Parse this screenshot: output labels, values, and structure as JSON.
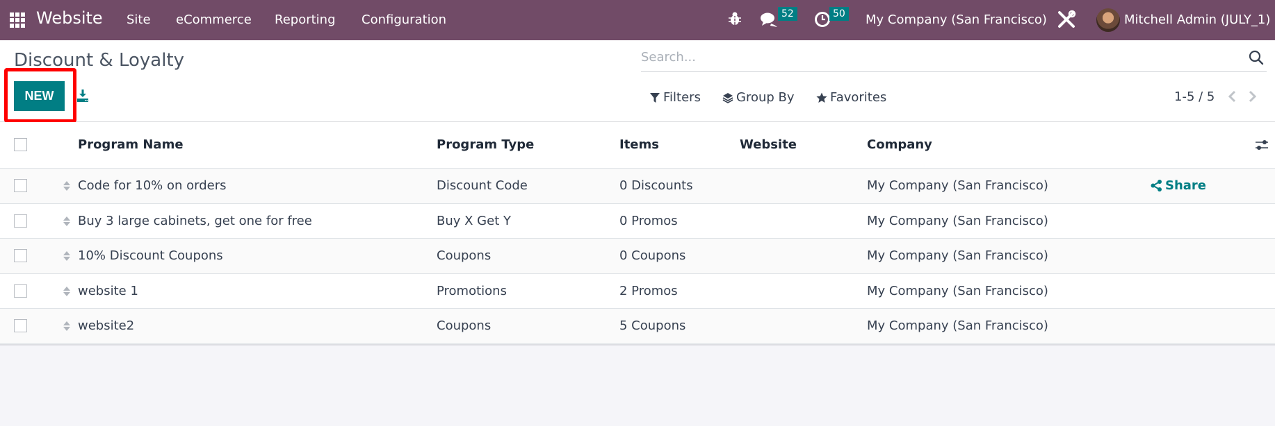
{
  "navbar": {
    "app_name": "Website",
    "menus": [
      "Site",
      "eCommerce",
      "Reporting",
      "Configuration"
    ],
    "messages_badge": "52",
    "activities_badge": "50",
    "company": "My Company (San Francisco)",
    "user": "Mitchell Admin (JULY_1)",
    "brand_color": "#714b67"
  },
  "control_panel": {
    "title": "Discount & Loyalty",
    "new_label": "NEW",
    "search_placeholder": "Search...",
    "search_value": "",
    "filters_label": "Filters",
    "group_by_label": "Group By",
    "favorites_label": "Favorites",
    "pager": "1-5 / 5",
    "accent_color": "#017e84"
  },
  "table": {
    "columns": [
      "Program Name",
      "Program Type",
      "Items",
      "Website",
      "Company"
    ],
    "rows": [
      {
        "name": "Code for 10% on orders",
        "type": "Discount Code",
        "items": "0 Discounts",
        "website": "",
        "company": "My Company (San Francisco)",
        "action": "Share"
      },
      {
        "name": "Buy 3 large cabinets, get one for free",
        "type": "Buy X Get Y",
        "items": "0 Promos",
        "website": "",
        "company": "My Company (San Francisco)",
        "action": ""
      },
      {
        "name": "10% Discount Coupons",
        "type": "Coupons",
        "items": "0 Coupons",
        "website": "",
        "company": "My Company (San Francisco)",
        "action": ""
      },
      {
        "name": "website 1",
        "type": "Promotions",
        "items": "2 Promos",
        "website": "",
        "company": "My Company (San Francisco)",
        "action": ""
      },
      {
        "name": "website2",
        "type": "Coupons",
        "items": "5 Coupons",
        "website": "",
        "company": "My Company (San Francisco)",
        "action": ""
      }
    ]
  }
}
